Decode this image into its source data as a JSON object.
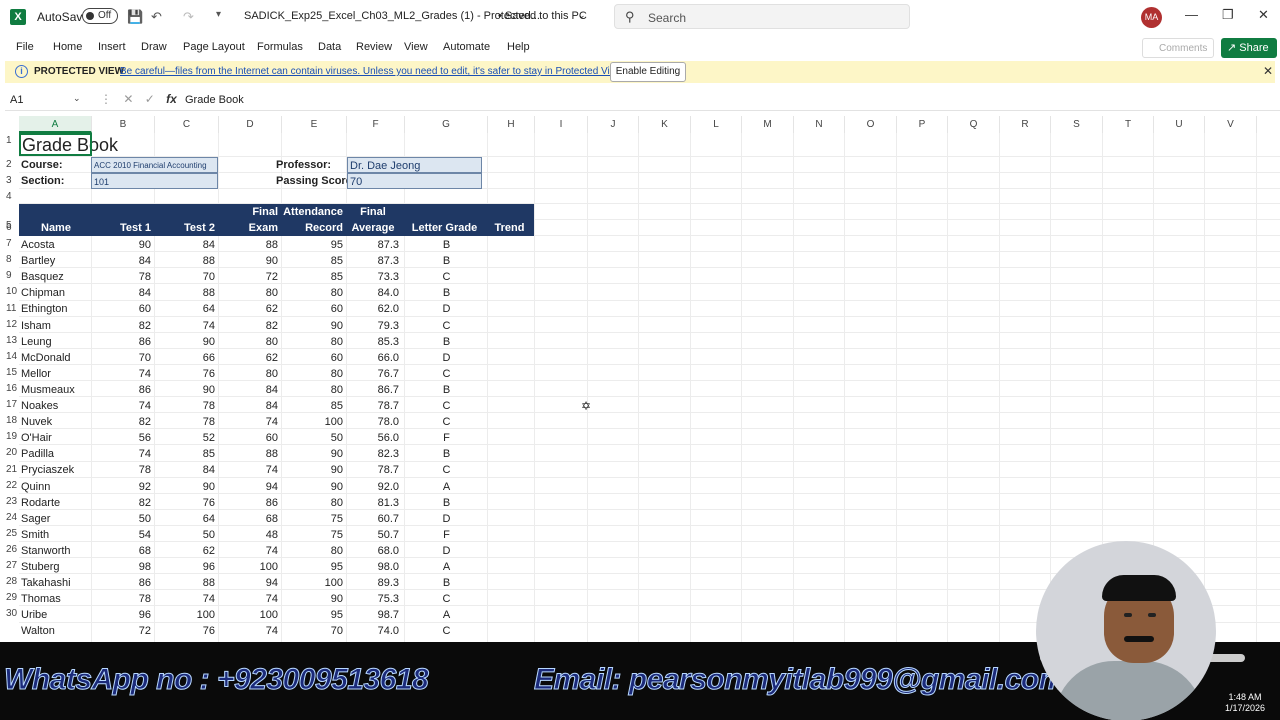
{
  "titlebar": {
    "autosave_label": "AutoSave",
    "autosave_state": "Off",
    "filename": "SADICK_Exp25_Excel_Ch03_ML2_Grades (1)  -  Protected...",
    "saved_status": "• Saved to this PC",
    "search_placeholder": "Search",
    "user_initials": "MA"
  },
  "menu": {
    "items": [
      "File",
      "Home",
      "Insert",
      "Draw",
      "Page Layout",
      "Formulas",
      "Data",
      "Review",
      "View",
      "Automate",
      "Help"
    ],
    "comments_label": "Comments",
    "share_label": "Share"
  },
  "protected_view": {
    "title": "PROTECTED VIEW",
    "message": "Be careful—files from the Internet can contain viruses. Unless you need to edit, it's safer to stay in Protected View.",
    "enable_button": "Enable Editing"
  },
  "formula_bar": {
    "name_box": "A1",
    "fx": "fx",
    "value": "Grade Book"
  },
  "sheet": {
    "columns": [
      "A",
      "B",
      "C",
      "D",
      "E",
      "F",
      "G",
      "H",
      "I",
      "J",
      "K",
      "L",
      "M",
      "N",
      "O",
      "P",
      "Q",
      "R",
      "S",
      "T",
      "U",
      "V"
    ],
    "row_numbers": [
      "1",
      "2",
      "3",
      "4",
      "5",
      "6",
      "7",
      "8",
      "9",
      "10",
      "11",
      "12",
      "13",
      "14",
      "15",
      "16",
      "17",
      "18",
      "19",
      "20",
      "21",
      "22",
      "23",
      "24",
      "25",
      "26",
      "27",
      "28",
      "29",
      "30"
    ],
    "title": "Grade Book",
    "course_label": "Course:",
    "course_value": "ACC 2010 Financial Accounting",
    "section_label": "Section:",
    "section_value": "101",
    "professor_label": "Professor:",
    "professor_value": "Dr. Dae Jeong",
    "passing_label": "Passing Score",
    "passing_value": "70",
    "headers_top": [
      "",
      "",
      "",
      "Final",
      "Attendance",
      "Final",
      "",
      ""
    ],
    "headers_bottom": [
      "Name",
      "Test 1",
      "Test 2",
      "Exam",
      "Record",
      "Average",
      "Letter Grade",
      "Trend"
    ],
    "students": [
      [
        "Acosta",
        "90",
        "84",
        "88",
        "95",
        "87.3",
        "B"
      ],
      [
        "Bartley",
        "84",
        "88",
        "90",
        "85",
        "87.3",
        "B"
      ],
      [
        "Basquez",
        "78",
        "70",
        "72",
        "85",
        "73.3",
        "C"
      ],
      [
        "Chipman",
        "84",
        "88",
        "80",
        "80",
        "84.0",
        "B"
      ],
      [
        "Ethington",
        "60",
        "64",
        "62",
        "60",
        "62.0",
        "D"
      ],
      [
        "Isham",
        "82",
        "74",
        "82",
        "90",
        "79.3",
        "C"
      ],
      [
        "Leung",
        "86",
        "90",
        "80",
        "80",
        "85.3",
        "B"
      ],
      [
        "McDonald",
        "70",
        "66",
        "62",
        "60",
        "66.0",
        "D"
      ],
      [
        "Mellor",
        "74",
        "76",
        "80",
        "80",
        "76.7",
        "C"
      ],
      [
        "Musmeaux",
        "86",
        "90",
        "84",
        "80",
        "86.7",
        "B"
      ],
      [
        "Noakes",
        "74",
        "78",
        "84",
        "85",
        "78.7",
        "C"
      ],
      [
        "Nuvek",
        "82",
        "78",
        "74",
        "100",
        "78.0",
        "C"
      ],
      [
        "O'Hair",
        "56",
        "52",
        "60",
        "50",
        "56.0",
        "F"
      ],
      [
        "Padilla",
        "74",
        "85",
        "88",
        "90",
        "82.3",
        "B"
      ],
      [
        "Pryciaszek",
        "78",
        "84",
        "74",
        "90",
        "78.7",
        "C"
      ],
      [
        "Quinn",
        "92",
        "90",
        "94",
        "90",
        "92.0",
        "A"
      ],
      [
        "Rodarte",
        "82",
        "76",
        "86",
        "80",
        "81.3",
        "B"
      ],
      [
        "Sager",
        "50",
        "64",
        "68",
        "75",
        "60.7",
        "D"
      ],
      [
        "Smith",
        "54",
        "50",
        "48",
        "75",
        "50.7",
        "F"
      ],
      [
        "Stanworth",
        "68",
        "62",
        "74",
        "80",
        "68.0",
        "D"
      ],
      [
        "Stuberg",
        "98",
        "96",
        "100",
        "95",
        "98.0",
        "A"
      ],
      [
        "Takahashi",
        "86",
        "88",
        "94",
        "100",
        "89.3",
        "B"
      ],
      [
        "Thomas",
        "78",
        "74",
        "74",
        "90",
        "75.3",
        "C"
      ],
      [
        "Uribe",
        "96",
        "100",
        "100",
        "95",
        "98.7",
        "A"
      ],
      [
        "Walton",
        "72",
        "76",
        "74",
        "70",
        "74.0",
        "C"
      ]
    ]
  },
  "overlay": {
    "whatsapp": "WhatsApp no : +923009513618",
    "email": "Email: pearsonmyitlab999@gmail.com",
    "time": "1:48 AM",
    "date": "1/17/2026"
  }
}
